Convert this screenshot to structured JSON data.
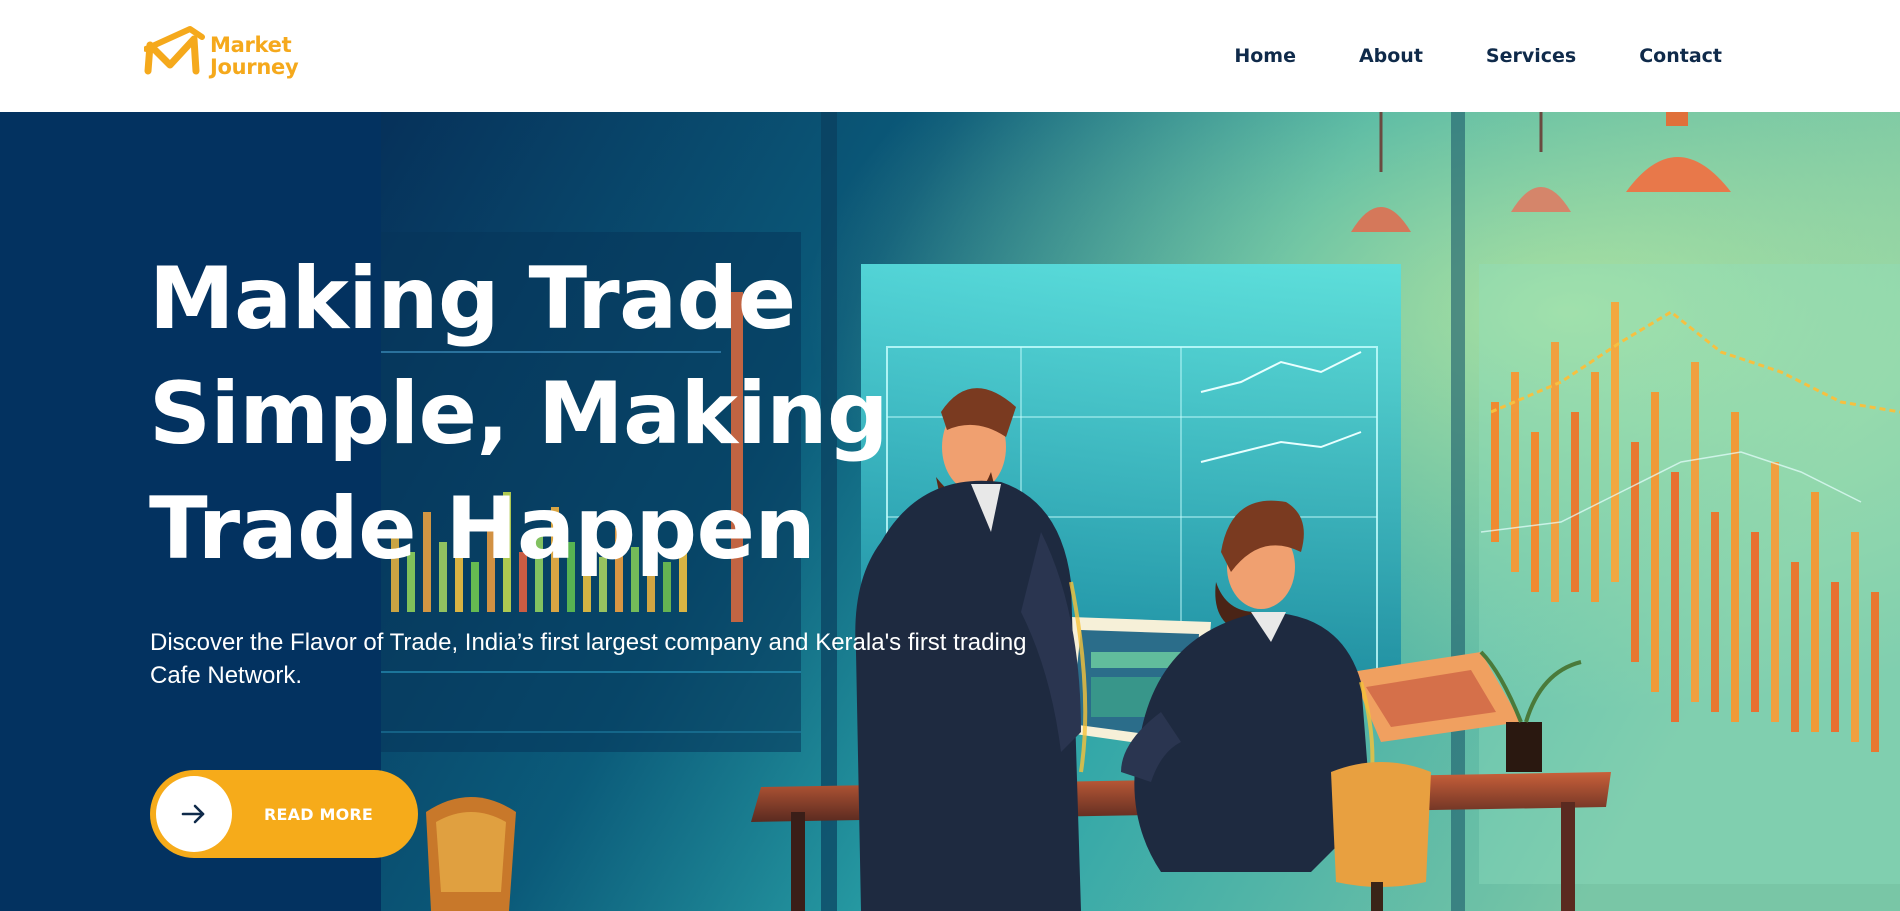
{
  "brand": {
    "name_line1": "Market",
    "name_line2": "Journey",
    "logo_icon": "m-roof-logo-icon",
    "color": "#f5a91c"
  },
  "nav": {
    "items": [
      {
        "label": "Home"
      },
      {
        "label": "About"
      },
      {
        "label": "Services"
      },
      {
        "label": "Contact"
      }
    ],
    "text_color": "#0f2a4a"
  },
  "hero": {
    "title_lines": [
      "Making Trade",
      "Simple, Making",
      "Trade Happen"
    ],
    "description": "Discover the Flavor of Trade, India’s first largest company and Kerala's first trading Cafe Network.",
    "cta": {
      "label": "READ MORE",
      "icon": "arrow-right-icon",
      "color": "#f6ab1a"
    },
    "background_color": "#033260"
  }
}
